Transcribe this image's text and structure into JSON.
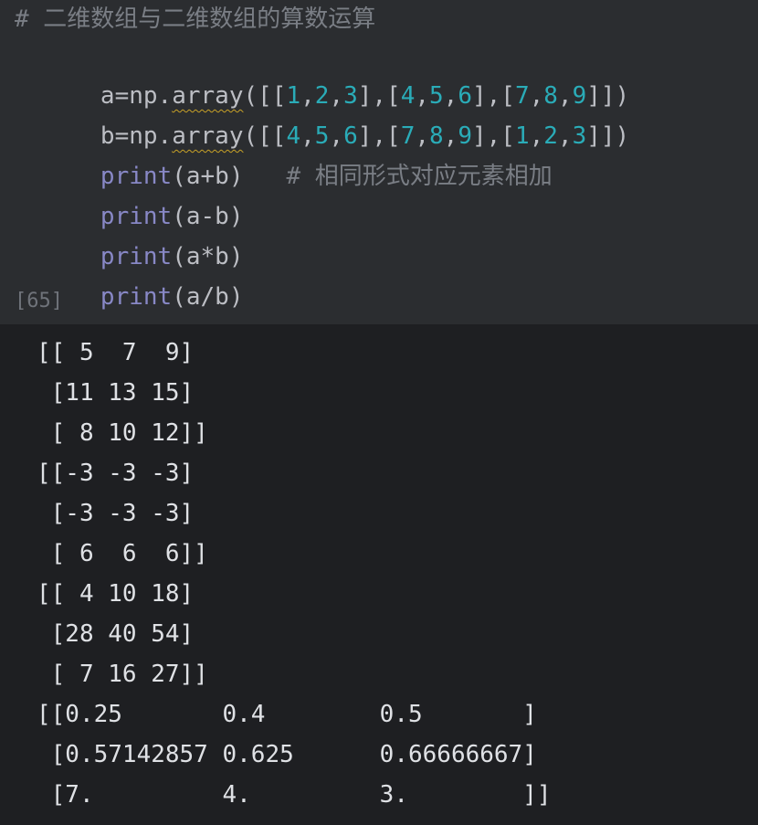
{
  "code": {
    "comment_line": "# 二维数组与二维数组的算数运算",
    "line_a": {
      "prefix": "a=np.",
      "func": "array",
      "args": [
        {
          "t": "p",
          "v": "([["
        },
        {
          "t": "n",
          "v": "1"
        },
        {
          "t": "p",
          "v": ","
        },
        {
          "t": "n",
          "v": "2"
        },
        {
          "t": "p",
          "v": ","
        },
        {
          "t": "n",
          "v": "3"
        },
        {
          "t": "p",
          "v": "],["
        },
        {
          "t": "n",
          "v": "4"
        },
        {
          "t": "p",
          "v": ","
        },
        {
          "t": "n",
          "v": "5"
        },
        {
          "t": "p",
          "v": ","
        },
        {
          "t": "n",
          "v": "6"
        },
        {
          "t": "p",
          "v": "],["
        },
        {
          "t": "n",
          "v": "7"
        },
        {
          "t": "p",
          "v": ","
        },
        {
          "t": "n",
          "v": "8"
        },
        {
          "t": "p",
          "v": ","
        },
        {
          "t": "n",
          "v": "9"
        },
        {
          "t": "p",
          "v": "]])"
        }
      ]
    },
    "line_b": {
      "prefix": "b=np.",
      "func": "array",
      "args": [
        {
          "t": "p",
          "v": "([["
        },
        {
          "t": "n",
          "v": "4"
        },
        {
          "t": "p",
          "v": ","
        },
        {
          "t": "n",
          "v": "5"
        },
        {
          "t": "p",
          "v": ","
        },
        {
          "t": "n",
          "v": "6"
        },
        {
          "t": "p",
          "v": "],["
        },
        {
          "t": "n",
          "v": "7"
        },
        {
          "t": "p",
          "v": ","
        },
        {
          "t": "n",
          "v": "8"
        },
        {
          "t": "p",
          "v": ","
        },
        {
          "t": "n",
          "v": "9"
        },
        {
          "t": "p",
          "v": "],["
        },
        {
          "t": "n",
          "v": "1"
        },
        {
          "t": "p",
          "v": ","
        },
        {
          "t": "n",
          "v": "2"
        },
        {
          "t": "p",
          "v": ","
        },
        {
          "t": "n",
          "v": "3"
        },
        {
          "t": "p",
          "v": "]])"
        }
      ]
    },
    "print_lines": [
      {
        "kw": "print",
        "args": "(a+b)",
        "comment": "   # 相同形式对应元素相加"
      },
      {
        "kw": "print",
        "args": "(a-b)",
        "comment": ""
      },
      {
        "kw": "print",
        "args": "(a*b)",
        "comment": ""
      },
      {
        "kw": "print",
        "args": "(a/b)",
        "comment": ""
      }
    ]
  },
  "execution_count": "[65]",
  "output_lines": [
    "[[ 5  7  9]",
    " [11 13 15]",
    " [ 8 10 12]]",
    "[[-3 -3 -3]",
    " [-3 -3 -3]",
    " [ 6  6  6]]",
    "[[ 4 10 18]",
    " [28 40 54]",
    " [ 7 16 27]]",
    "[[0.25       0.4        0.5       ]",
    " [0.57142857 0.625      0.66666667]",
    " [7.         4.         3.        ]]"
  ],
  "colors": {
    "code_bg": "#2b2d30",
    "output_bg": "#1e1f22",
    "comment": "#7a7e85",
    "keyword_print": "#8888c6",
    "number": "#2aacb8",
    "text": "#bcbec4",
    "output_text": "#dfe1e5"
  }
}
